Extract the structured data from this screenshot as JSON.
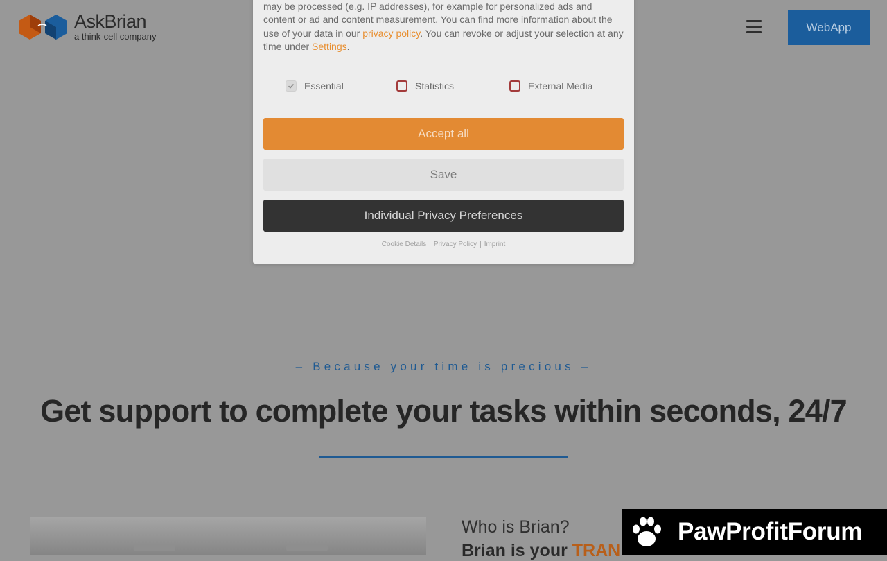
{
  "header": {
    "logo": {
      "name": "AskBrian",
      "tagline": "a think-cell company"
    },
    "menu_icon": "hamburger-menu-icon",
    "webapp_label": "WebApp"
  },
  "cookie_modal": {
    "text_part1": "while others help us to improve this website and your experience. Personal data may be processed (e.g. IP addresses), for example for personalized ads and content or ad and content measurement. You can find more information about the use of your data in our ",
    "privacy_link": "privacy policy",
    "text_part2": ". You can revoke or adjust your selection at any time under ",
    "settings_link": "Settings",
    "text_part3": ".",
    "checkboxes": [
      {
        "label": "Essential",
        "checked": true
      },
      {
        "label": "Statistics",
        "checked": false
      },
      {
        "label": "External Media",
        "checked": false
      }
    ],
    "accept_all": "Accept all",
    "save": "Save",
    "individual_prefs": "Individual Privacy Preferences",
    "footer_links": [
      "Cookie Details",
      "Privacy Policy",
      "Imprint"
    ],
    "footer_separator": "|"
  },
  "hero": {
    "tagline": "– Because your time is precious –",
    "headline": "Get support to complete your tasks within seconds, 24/7"
  },
  "about": {
    "who": "Who is Brian?",
    "brian_prefix": "Brian is your ",
    "brian_accent": "TRAN"
  },
  "watermark": {
    "text": "PawProfitForum",
    "icon": "paw-icon"
  },
  "colors": {
    "overlay_bg": "#989898",
    "accent_orange": "#e38a33",
    "brand_blue": "#1b5d9c",
    "dark_button": "#333333"
  }
}
